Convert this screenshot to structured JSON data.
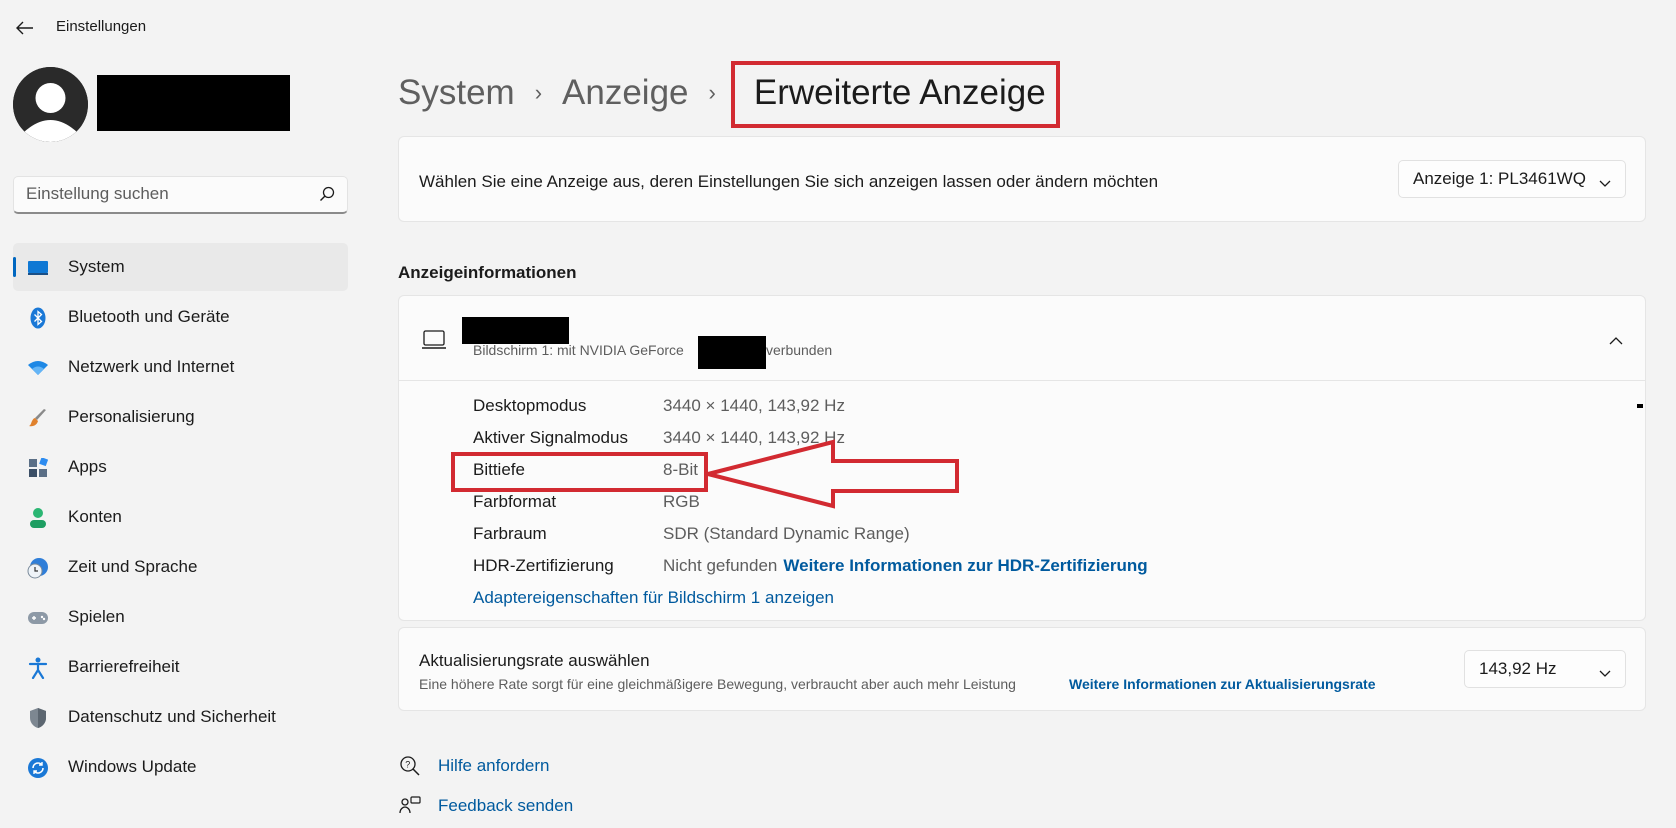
{
  "app": {
    "title": "Einstellungen"
  },
  "search": {
    "placeholder": "Einstellung suchen"
  },
  "sidebar": {
    "items": [
      {
        "label": "System",
        "icon": "monitor-icon"
      },
      {
        "label": "Bluetooth und Geräte",
        "icon": "bluetooth-icon"
      },
      {
        "label": "Netzwerk und Internet",
        "icon": "wifi-icon"
      },
      {
        "label": "Personalisierung",
        "icon": "brush-icon"
      },
      {
        "label": "Apps",
        "icon": "apps-icon"
      },
      {
        "label": "Konten",
        "icon": "person-icon"
      },
      {
        "label": "Zeit und Sprache",
        "icon": "clock-globe-icon"
      },
      {
        "label": "Spielen",
        "icon": "gamepad-icon"
      },
      {
        "label": "Barrierefreiheit",
        "icon": "accessibility-icon"
      },
      {
        "label": "Datenschutz und Sicherheit",
        "icon": "shield-icon"
      },
      {
        "label": "Windows Update",
        "icon": "update-icon"
      }
    ]
  },
  "breadcrumb": {
    "level1": "System",
    "level2": "Anzeige",
    "current": "Erweiterte Anzeige"
  },
  "display_select": {
    "text": "Wählen Sie eine Anzeige aus, deren Einstellungen Sie sich anzeigen lassen oder ändern möchten",
    "value": "Anzeige 1: PL3461WQ"
  },
  "info": {
    "section_title": "Anzeigeinformationen",
    "subtitle_start": "Bildschirm 1: mit NVIDIA GeForce",
    "subtitle_end": "verbunden",
    "rows": [
      {
        "key": "Desktopmodus",
        "value": "3440 × 1440, 143,92 Hz"
      },
      {
        "key": "Aktiver Signalmodus",
        "value": "3440 × 1440, 143,92 Hz"
      },
      {
        "key": "Bittiefe",
        "value": "8-Bit"
      },
      {
        "key": "Farbformat",
        "value": "RGB"
      },
      {
        "key": "Farbraum",
        "value": "SDR (Standard Dynamic Range)"
      }
    ],
    "hdr_key": "HDR-Zertifizierung",
    "hdr_value": "Nicht gefunden",
    "hdr_link": "Weitere Informationen zur HDR-Zertifizierung",
    "adapter_link": "Adaptereigenschaften für Bildschirm 1 anzeigen"
  },
  "refresh": {
    "title": "Aktualisierungsrate auswählen",
    "subtitle": "Eine höhere Rate sorgt für eine gleichmäßigere Bewegung, verbraucht aber auch mehr Leistung",
    "link": "Weitere Informationen zur Aktualisierungsrate",
    "value": "143,92 Hz"
  },
  "footer": {
    "help": "Hilfe anfordern",
    "feedback": "Feedback senden"
  },
  "colors": {
    "accent": "#0067c0",
    "link": "#005a9e",
    "annotation": "#d22a31"
  }
}
